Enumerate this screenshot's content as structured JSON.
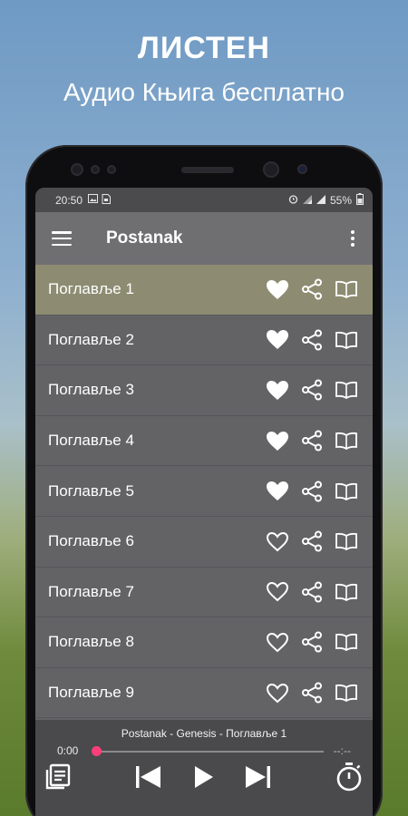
{
  "promo": {
    "title": "ЛИСТЕН",
    "subtitle": "Аудио Књига бесплатно"
  },
  "statusbar": {
    "time": "20:50",
    "battery": "55%",
    "icons": [
      "image-icon",
      "sim-icon",
      "alarm-icon",
      "signal-icon",
      "wifi-icon",
      "battery-icon"
    ]
  },
  "toolbar": {
    "title": "Postanak"
  },
  "chapters": [
    {
      "label": "Поглавље 1",
      "favorite": true,
      "selected": true
    },
    {
      "label": "Поглавље 2",
      "favorite": true,
      "selected": false
    },
    {
      "label": "Поглавље 3",
      "favorite": true,
      "selected": false
    },
    {
      "label": "Поглавље 4",
      "favorite": true,
      "selected": false
    },
    {
      "label": "Поглавље 5",
      "favorite": true,
      "selected": false
    },
    {
      "label": "Поглавље 6",
      "favorite": false,
      "selected": false
    },
    {
      "label": "Поглавље 7",
      "favorite": false,
      "selected": false
    },
    {
      "label": "Поглавље 8",
      "favorite": false,
      "selected": false
    },
    {
      "label": "Поглавље 9",
      "favorite": false,
      "selected": false
    }
  ],
  "player": {
    "now_playing": "Postanak - Genesis - Поглавље 1",
    "elapsed": "0:00",
    "remaining": "--:--",
    "progress": 0
  },
  "colors": {
    "selected_row": "#8d8c72",
    "progress_knob": "#ff3f7a"
  }
}
